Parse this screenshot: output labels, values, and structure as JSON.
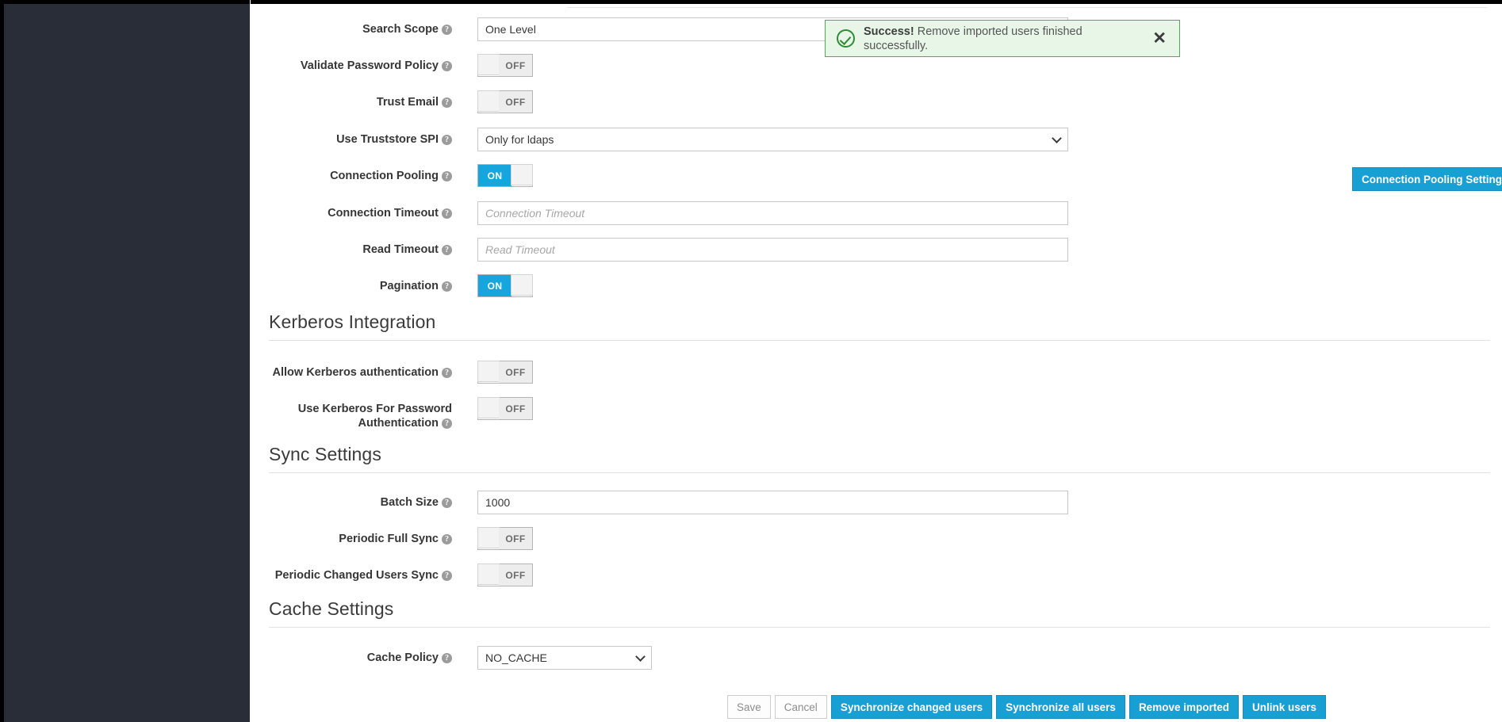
{
  "alert": {
    "icon": "check-circle-icon",
    "strong": "Success!",
    "message": " Remove imported users finished successfully.",
    "close_label": "✕",
    "border_color": "#52a954",
    "background_color": "#e8f6e8"
  },
  "colors": {
    "primary": "#189fd4",
    "toggle_on": "#16a5dd",
    "sidebar": "#282d37",
    "success": "#52a954"
  },
  "ldap_settings": {
    "rows": [
      {
        "label": "Search Scope",
        "type": "select",
        "value": "One Level"
      },
      {
        "label": "Validate Password Policy",
        "type": "toggle",
        "value": "OFF"
      },
      {
        "label": "Trust Email",
        "type": "toggle",
        "value": "OFF"
      },
      {
        "label": "Use Truststore SPI",
        "type": "select",
        "value": "Only for ldaps"
      },
      {
        "label": "Connection Pooling",
        "type": "toggle",
        "value": "ON"
      },
      {
        "label": "Connection Timeout",
        "type": "text",
        "value": "",
        "placeholder": "Connection Timeout"
      },
      {
        "label": "Read Timeout",
        "type": "text",
        "value": "",
        "placeholder": "Read Timeout"
      },
      {
        "label": "Pagination",
        "type": "toggle",
        "value": "ON"
      }
    ],
    "pooling_button": "Connection Pooling Settings"
  },
  "kerberos": {
    "title": "Kerberos Integration",
    "rows": [
      {
        "label": "Allow Kerberos authentication",
        "type": "toggle",
        "value": "OFF"
      },
      {
        "label": "Use Kerberos For Password Authentication",
        "type": "toggle",
        "value": "OFF"
      }
    ]
  },
  "sync": {
    "title": "Sync Settings",
    "rows": [
      {
        "label": "Batch Size",
        "type": "text",
        "value": "1000",
        "placeholder": ""
      },
      {
        "label": "Periodic Full Sync",
        "type": "toggle",
        "value": "OFF"
      },
      {
        "label": "Periodic Changed Users Sync",
        "type": "toggle",
        "value": "OFF"
      }
    ]
  },
  "cache": {
    "title": "Cache Settings",
    "rows": [
      {
        "label": "Cache Policy",
        "type": "select",
        "value": "NO_CACHE"
      }
    ]
  },
  "actions": {
    "save": "Save",
    "cancel": "Cancel",
    "sync_changed": "Synchronize changed users",
    "sync_all": "Synchronize all users",
    "remove_imported": "Remove imported",
    "unlink_users": "Unlink users"
  },
  "help_glyph": "?"
}
